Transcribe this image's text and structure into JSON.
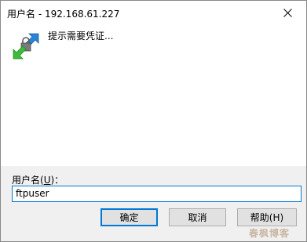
{
  "window": {
    "title": "用户名 - 192.168.61.227"
  },
  "prompt": {
    "text": "提示需要凭证..."
  },
  "username": {
    "label_prefix": "用户名(",
    "label_mnemonic": "U",
    "label_suffix": ")：",
    "value": "ftpuser"
  },
  "buttons": {
    "ok": "确定",
    "cancel": "取消",
    "help": "帮助(H)"
  },
  "watermark": {
    "text": "春枫博客"
  },
  "icons": {
    "close": "close-icon",
    "app": "network-transfer-icon"
  },
  "colors": {
    "focus": "#0078d7",
    "footer_bg": "#f0f0f0",
    "button_bg": "#e1e1e1",
    "arrow_blue": "#2a84d6",
    "arrow_green": "#3dbb3d"
  }
}
